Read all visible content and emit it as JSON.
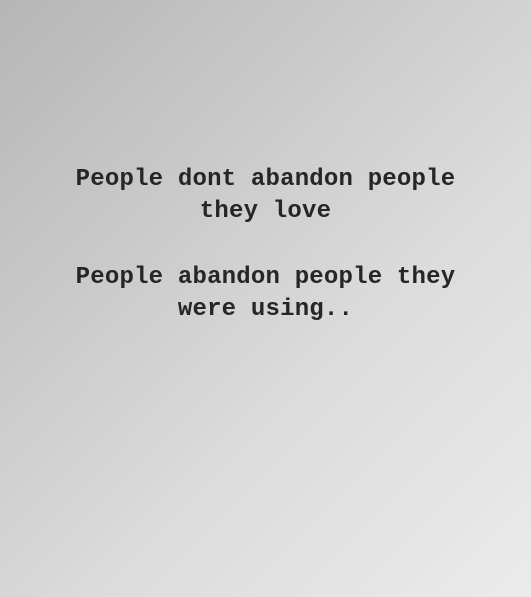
{
  "quote": {
    "paragraph_1": {
      "line_1": "People dont abandon people",
      "line_2": "they love"
    },
    "paragraph_2": {
      "line_1": "People abandon people they",
      "line_2": "were using.."
    }
  },
  "colors": {
    "text": "#262626",
    "background_dark": "#b6b6b6",
    "background_light": "#ebebeb"
  }
}
